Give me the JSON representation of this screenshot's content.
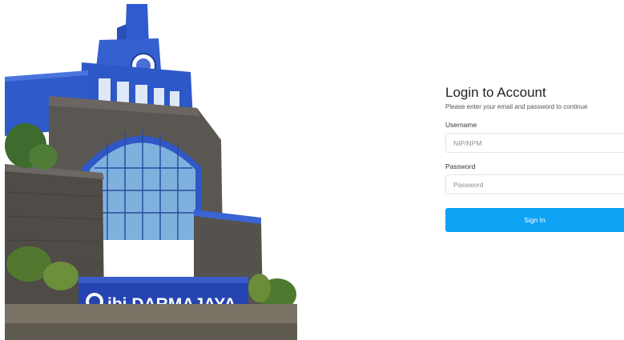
{
  "photo": {
    "sign_text": "ibi DARMAJAYA",
    "colors": {
      "sky": "#ffffff",
      "wall_blue": "#2d58c8",
      "stone": "#5a5651",
      "glass": "#7fb1de",
      "sign": "#2644b0"
    }
  },
  "login": {
    "title": "Login to Account",
    "subtitle": "Please enter your email and password to continue",
    "username_label": "Username",
    "username_placeholder": "NIP/NPM",
    "password_label": "Password",
    "password_placeholder": "Password",
    "signin_label": "Sign In",
    "accent": "#0fa3f5"
  }
}
